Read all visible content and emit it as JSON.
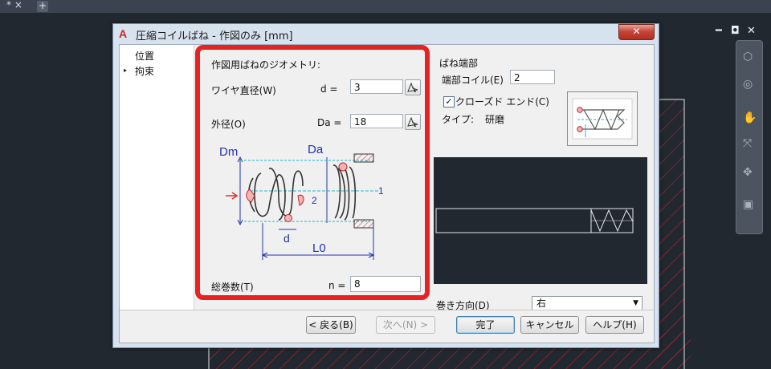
{
  "tabbar": {
    "close_glyph": "* ×",
    "add_glyph": "+"
  },
  "app_controls": {
    "minimize": "━",
    "restore": "◘",
    "close": "✕"
  },
  "dialog": {
    "title": "圧縮コイルばね - 作図のみ [mm]",
    "close_glyph": "✕",
    "nav": {
      "items": [
        "位置",
        "拘束"
      ],
      "selected_marker": "▸"
    },
    "geometry": {
      "heading": "作図用ばねのジオメトリ:",
      "wire_label": "ワイヤ直径(W)",
      "wire_symbol": "d =",
      "wire_value": "3",
      "outer_label": "外径(O)",
      "outer_symbol": "Da =",
      "outer_value": "18",
      "diagram": {
        "dm": "Dm",
        "da": "Da",
        "d": "d",
        "l0": "L0",
        "n1": "1",
        "n2": "2"
      },
      "turns_label": "総巻数(T)",
      "turns_symbol": "n =",
      "turns_value": "8"
    },
    "end": {
      "group_label": "ばね端部",
      "end_coils_label": "端部コイル(E)",
      "end_coils_value": "2",
      "closed_label": "クローズド エンド(C)",
      "closed_checked": true,
      "type_label": "タイプ:",
      "type_value": "研磨"
    },
    "winding": {
      "label": "巻き方向(D)",
      "value": "右"
    },
    "buttons": {
      "back": "< 戻る(B)",
      "next": "次へ(N) >",
      "finish": "完了",
      "cancel": "キャンセル",
      "help": "ヘルプ(H)"
    }
  },
  "colors": {
    "highlight_border": "#e62222",
    "drawing_bg": "#212830",
    "hatch": "#c0272d"
  }
}
